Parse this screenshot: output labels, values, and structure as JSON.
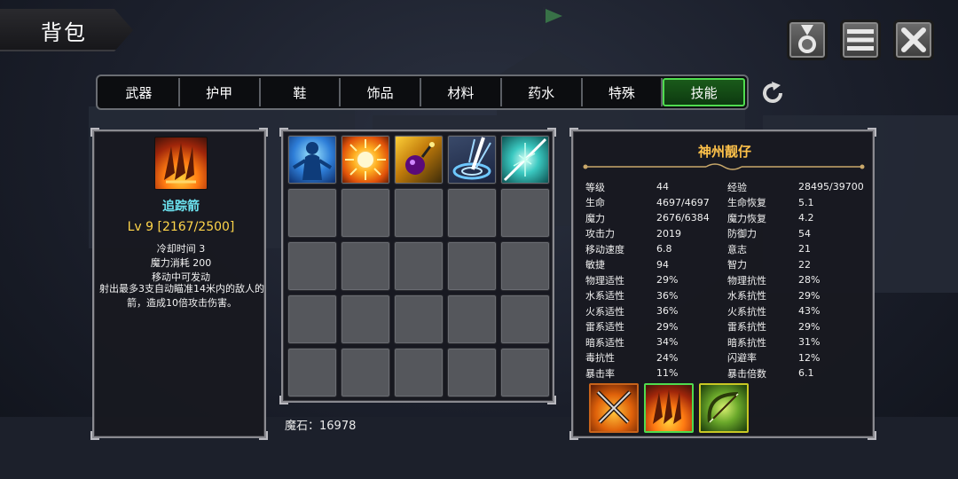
{
  "header": {
    "title": "背包"
  },
  "top_buttons": [
    {
      "name": "medal-button",
      "icon": "medal-icon"
    },
    {
      "name": "menu-button",
      "icon": "menu-icon"
    },
    {
      "name": "close-button",
      "icon": "close-icon"
    }
  ],
  "tabs": [
    {
      "label": "武器",
      "active": false
    },
    {
      "label": "护甲",
      "active": false
    },
    {
      "label": "鞋",
      "active": false
    },
    {
      "label": "饰品",
      "active": false
    },
    {
      "label": "材料",
      "active": false
    },
    {
      "label": "药水",
      "active": false
    },
    {
      "label": "特殊",
      "active": false
    },
    {
      "label": "技能",
      "active": true
    }
  ],
  "refresh": {
    "icon": "refresh-icon"
  },
  "skill_detail": {
    "icon": "claw-fire-icon",
    "name": "追踪箭",
    "level": "Lv 9 [2167/2500]",
    "cooldown": "冷却时间 3",
    "mana_cost": "魔力消耗 200",
    "move_cast": "移动中可发动",
    "description": "射出最多3支自动瞄准14米内的敌人的箭，造成10倍攻击伤害。"
  },
  "skill_grid": {
    "slots": [
      {
        "icon": "spirit-body-icon"
      },
      {
        "icon": "sun-burst-icon"
      },
      {
        "icon": "bomb-icon"
      },
      {
        "icon": "target-hit-icon"
      },
      {
        "icon": "lightning-strike-icon"
      }
    ],
    "total_slots": 25
  },
  "currency": {
    "text": "魔石：16978"
  },
  "character": {
    "name": "神州靓仔",
    "stats": [
      [
        "等级",
        "44",
        "经验",
        "28495/39700"
      ],
      [
        "生命",
        "4697/4697",
        "生命恢复",
        "5.1"
      ],
      [
        "魔力",
        "2676/6384",
        "魔力恢复",
        "4.2"
      ],
      [
        "攻击力",
        "2019",
        "防御力",
        "54"
      ],
      [
        "移动速度",
        "6.8",
        "意志",
        "21"
      ],
      [
        "敏捷",
        "94",
        "智力",
        "22"
      ],
      [
        "物理适性",
        "29%",
        "物理抗性",
        "28%"
      ],
      [
        "水系适性",
        "36%",
        "水系抗性",
        "29%"
      ],
      [
        "火系适性",
        "36%",
        "火系抗性",
        "43%"
      ],
      [
        "雷系适性",
        "29%",
        "雷系抗性",
        "29%"
      ],
      [
        "暗系适性",
        "34%",
        "暗系抗性",
        "31%"
      ],
      [
        "毒抗性",
        "24%",
        "闪避率",
        "12%"
      ],
      [
        "暴击率",
        "11%",
        "暴击倍数",
        "6.1"
      ]
    ],
    "equipped": [
      {
        "icon": "crossed-swords-icon",
        "border": "#c8631a"
      },
      {
        "icon": "claw-fire-icon",
        "border": "#4fdc4f"
      },
      {
        "icon": "bow-icon",
        "border": "#c8c824"
      }
    ]
  }
}
